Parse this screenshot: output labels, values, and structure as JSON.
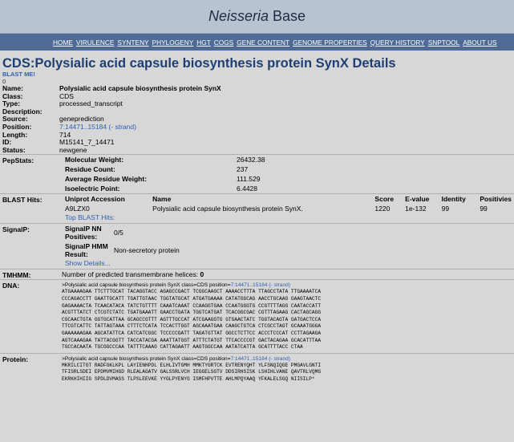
{
  "site": {
    "title_italic": "Neisseria",
    "title_rest": " Base"
  },
  "nav": [
    "HOME",
    "VIRULENCE",
    "SYNTENY",
    "PHYLOGENY",
    "HGT",
    "COGS",
    "GENE CONTENT",
    "GENOME PROPERTIES",
    "QUERY HISTORY",
    "SNPTOOL",
    "ABOUT US"
  ],
  "cds": {
    "title": "CDS:Polysialic acid capsule biosynthesis protein SynX Details",
    "blast_me": "BLAST ME!",
    "zero": "0"
  },
  "details": [
    {
      "label": "Name:",
      "value": "Polysialic acid capsule biosynthesis protein SynX",
      "bold": true
    },
    {
      "label": "Class:",
      "value": "CDS"
    },
    {
      "label": "Type:",
      "value": "processed_transcript"
    },
    {
      "label": "Description:",
      "value": ""
    },
    {
      "label": "Source:",
      "value": "geneprediction"
    },
    {
      "label": "Position:",
      "value": "7:14471..15184 (- strand)",
      "link": true
    },
    {
      "label": "Length:",
      "value": "714"
    },
    {
      "label": "ID:",
      "value": "M15141_7_14471"
    },
    {
      "label": "Status:",
      "value": "newgene"
    }
  ],
  "pepstats": {
    "label": "PepStats:",
    "rows": [
      {
        "k": "Molecular Weight:",
        "v": "26432.38"
      },
      {
        "k": "Residue Count:",
        "v": "237"
      },
      {
        "k": "Average Residue Weight:",
        "v": "111.529"
      },
      {
        "k": "Isoelectric Point:",
        "v": "6.4428"
      }
    ]
  },
  "blast": {
    "label": "BLAST Hits:",
    "headers": {
      "acc": "Uniprot Accession",
      "name": "Name",
      "score": "Score",
      "evalue": "E-value",
      "identity": "Identity",
      "positives": "Positivies"
    },
    "row": {
      "acc": "A9LZX0",
      "name": "Polysialic acid capsule biosynthesis protein SynX.",
      "score": "1220",
      "evalue": "1e-132",
      "identity": "99",
      "positives": "99"
    },
    "top_link": "Top BLAST Hits:"
  },
  "signalp": {
    "label": "SignalP:",
    "nn_label": "SignalP NN Positives:",
    "nn_value": "0/5",
    "hmm_label": "SignalP HMM Result:",
    "hmm_value": "Non-secretory protein",
    "show_details": "Show Details..."
  },
  "tmhmm": {
    "label": "TMHMM:",
    "text": "Number of predicted transmembrane helices: ",
    "count": "0"
  },
  "dna": {
    "label": "DNA:",
    "header_prefix": ">Polysialic acid capsule biosynthesis protein SynX class=CDS position=",
    "header_link": "7:14471..15184 (- strand)",
    "lines": [
      "ATGAAAAGAA TTCTTTGCAT TACAGGTACC AGAGCCGACT TCGGCAAGCT AAAACCTTTA TTAGCCTATA TTGAAAATCA",
      "CCCAGACCTT GAATTGCATT TGATTGTAAC TGGTATGCAT ATGATGAAAA CATATGGCAG AACCTGCAAG GAAGTAACTC",
      "GAGAAAACTA TCAACATACA TATCTGTTTT CAAATCAAAT CCAAGGTGAA CCAATGGGTG CCGTTTTAGG CAATACCATT",
      "ACGTTTATCT CTCGTCTATC TGATGAAATT GAACCTGATA TGGTCATGAT TCACGGCGAC CGTTTAGAAG CACTAGCAGG",
      "CGCAACTGTA GGTGCATTAA GCAGCCGTTT AGTTTGCCAT ATCGAAGGTG GTGAACTATC TGGTACAGTA GATGACTCCA",
      "TTCGTCATTC TATTAGTAAA CTTTCTCATA TCCACTTGGT AGCAAATGAA CAAGCTGTCA CTCGCCTAGT GCAAATGGGA",
      "GAAAAAAGAA AGCATATTCA CATCATCGGC TCCCCCGATT TAGATGTTAT GGCCTCTTCC ACCCTCCCAT CCTTAGAAGA",
      "AGTCAAAGAA TATTACGGTT TACCATACGA AAATTATGGT ATTTCTATGT TTCACCCCGT GACTACAGAA GCACATTTAA",
      "TGCCACAATA TGCGGCCCAA TATTTCAAAG CATTAGAATT AAGTGGCCAA AATATCATTA GCATTTTACC CTAA"
    ]
  },
  "protein": {
    "label": "Protein:",
    "header_prefix": ">Polysialic acid capsule biosynthesis protein SynX class=CDS position=",
    "header_link": "7:14471..15184 (- strand)",
    "lines": [
      "MKRILCITGT RADFGKLKPL LAYIENHPDL ELHLIVTGMH MMKTYGRTCK EVTRENYQHT YLFSNQIQGE PMGAVLGNTI",
      "TFISRLSDEI EPDMVMIHGD RLEALAGATV GALSSRLVCH IEGGELSGTV DDSIRHSISK LSHIHLVANE QAVTRLVQMG",
      "EKRKHIHIIG SPDLDVMASS TLPSLEEVKE YYGLPYENYG ISMFHPVTTE AHLMPQYAAQ YFKALELSGQ NIISILP*"
    ]
  }
}
